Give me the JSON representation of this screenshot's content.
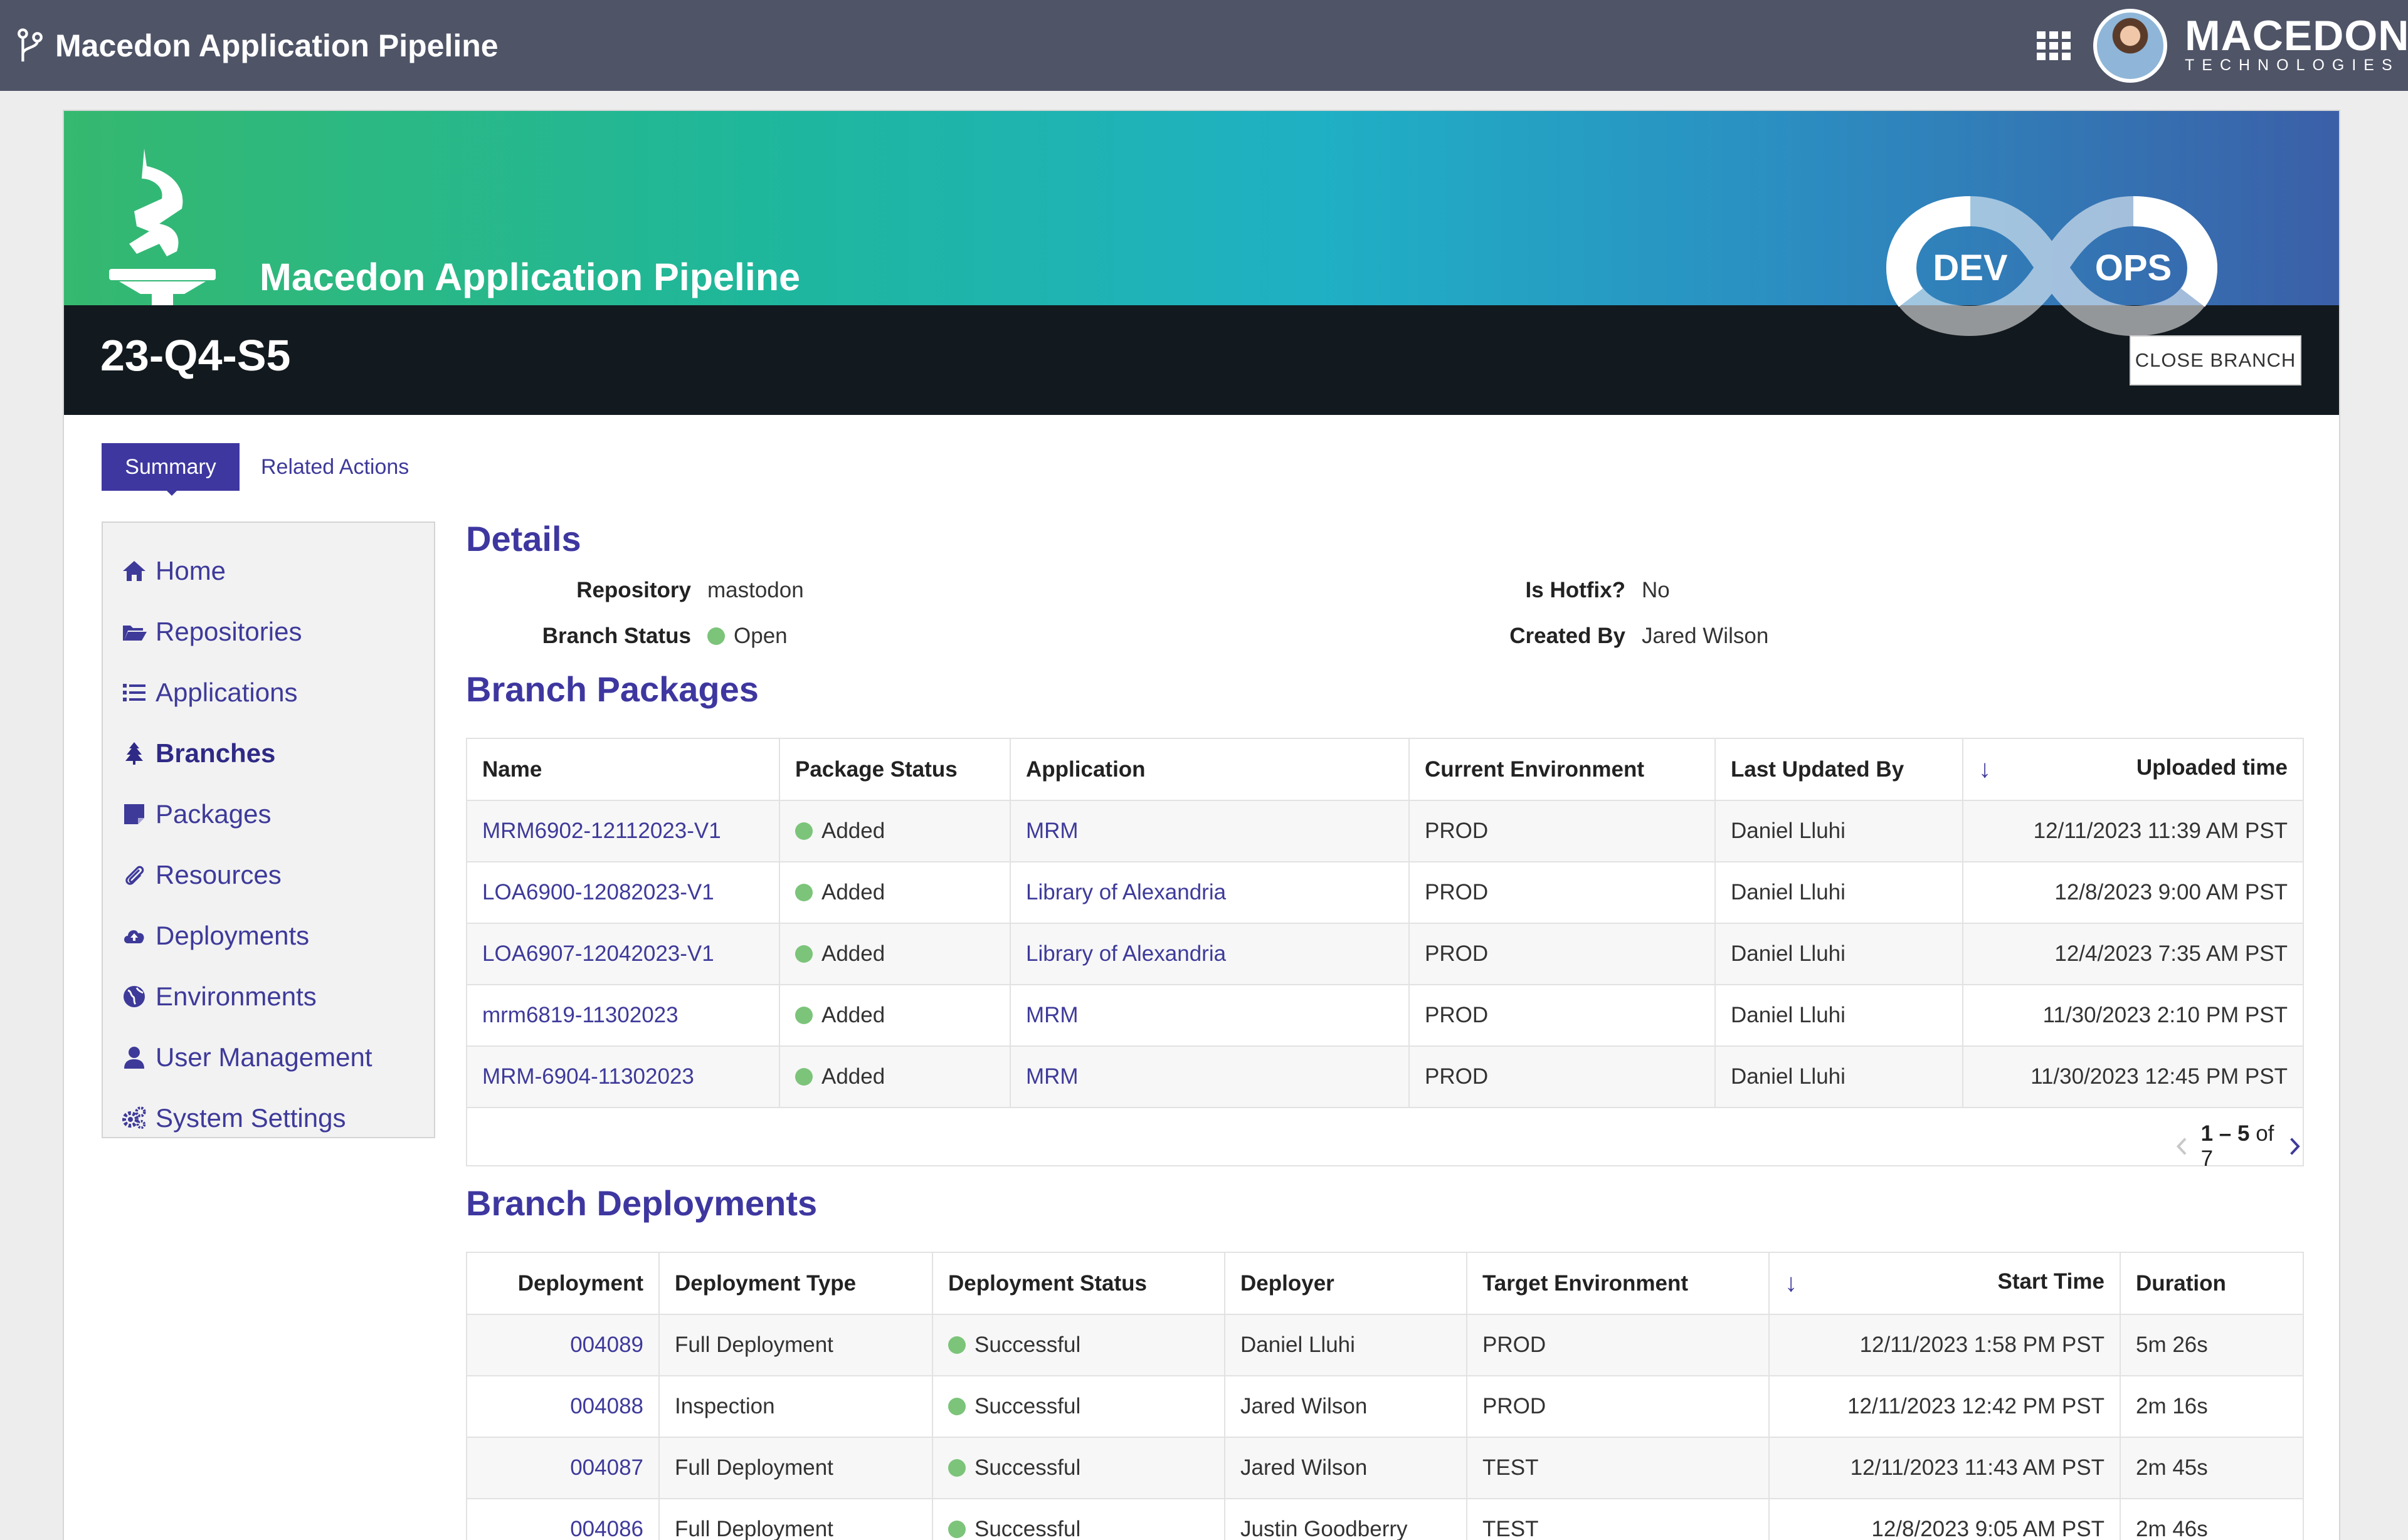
{
  "topbar": {
    "app_title": "Macedon Application Pipeline",
    "brand_name": "MACEDON",
    "brand_sub": "TECHNOLOGIES"
  },
  "hero": {
    "title": "Macedon Application Pipeline",
    "branch_name": "23-Q4-S5",
    "devops_left": "DEV",
    "devops_right": "OPS",
    "close_button": "CLOSE BRANCH"
  },
  "tabs": [
    {
      "label": "Summary",
      "active": true
    },
    {
      "label": "Related Actions",
      "active": false
    }
  ],
  "sidebar": {
    "items": [
      {
        "label": "Home",
        "icon": "home-icon"
      },
      {
        "label": "Repositories",
        "icon": "folder-open-icon"
      },
      {
        "label": "Applications",
        "icon": "list-icon"
      },
      {
        "label": "Branches",
        "icon": "tree-icon",
        "active": true
      },
      {
        "label": "Packages",
        "icon": "package-icon"
      },
      {
        "label": "Resources",
        "icon": "paperclip-icon"
      },
      {
        "label": "Deployments",
        "icon": "cloud-upload-icon"
      },
      {
        "label": "Environments",
        "icon": "globe-icon"
      },
      {
        "label": "User Management",
        "icon": "user-icon"
      },
      {
        "label": "System Settings",
        "icon": "cogs-icon"
      }
    ]
  },
  "details": {
    "title": "Details",
    "repository_label": "Repository",
    "repository_value": "mastodon",
    "branch_status_label": "Branch Status",
    "branch_status_value": "Open",
    "hotfix_label": "Is Hotfix?",
    "hotfix_value": "No",
    "created_by_label": "Created By",
    "created_by_value": "Jared Wilson"
  },
  "packages": {
    "title": "Branch Packages",
    "columns": [
      "Name",
      "Package Status",
      "Application",
      "Current Environment",
      "Last Updated By",
      "Uploaded time"
    ],
    "rows": [
      {
        "name": "MRM6902-12112023-V1",
        "status": "Added",
        "application": "MRM",
        "env": "PROD",
        "updated_by": "Daniel Lluhi",
        "uploaded": "12/11/2023 11:39 AM  PST"
      },
      {
        "name": "LOA6900-12082023-V1",
        "status": "Added",
        "application": "Library of Alexandria",
        "env": "PROD",
        "updated_by": "Daniel Lluhi",
        "uploaded": "12/8/2023 9:00 AM  PST"
      },
      {
        "name": "LOA6907-12042023-V1",
        "status": "Added",
        "application": "Library of Alexandria",
        "env": "PROD",
        "updated_by": "Daniel Lluhi",
        "uploaded": "12/4/2023 7:35 AM  PST"
      },
      {
        "name": "mrm6819-11302023",
        "status": "Added",
        "application": "MRM",
        "env": "PROD",
        "updated_by": "Daniel Lluhi",
        "uploaded": "11/30/2023 2:10 PM  PST"
      },
      {
        "name": "MRM-6904-11302023",
        "status": "Added",
        "application": "MRM",
        "env": "PROD",
        "updated_by": "Daniel Lluhi",
        "uploaded": "11/30/2023 12:45 PM  PST"
      }
    ],
    "pager_range": "1 – 5",
    "pager_total": "of 7"
  },
  "deployments": {
    "title": "Branch Deployments",
    "columns": [
      "Deployment",
      "Deployment Type",
      "Deployment Status",
      "Deployer",
      "Target Environment",
      "Start Time",
      "Duration"
    ],
    "rows": [
      {
        "id": "004089",
        "type": "Full Deployment",
        "status": "Successful",
        "deployer": "Daniel Lluhi",
        "target": "PROD",
        "start": "12/11/2023 1:58 PM  PST",
        "duration": "5m 26s"
      },
      {
        "id": "004088",
        "type": "Inspection",
        "status": "Successful",
        "deployer": "Jared Wilson",
        "target": "PROD",
        "start": "12/11/2023 12:42 PM  PST",
        "duration": "2m 16s"
      },
      {
        "id": "004087",
        "type": "Full Deployment",
        "status": "Successful",
        "deployer": "Jared Wilson",
        "target": "TEST",
        "start": "12/11/2023 11:43 AM  PST",
        "duration": "2m 45s"
      },
      {
        "id": "004086",
        "type": "Full Deployment",
        "status": "Successful",
        "deployer": "Justin Goodberry",
        "target": "TEST",
        "start": "12/8/2023 9:05 AM  PST",
        "duration": "2m 46s"
      }
    ]
  },
  "colors": {
    "accent": "#3e37a0",
    "topbar": "#4f5467",
    "status_green": "#7cc47a"
  }
}
